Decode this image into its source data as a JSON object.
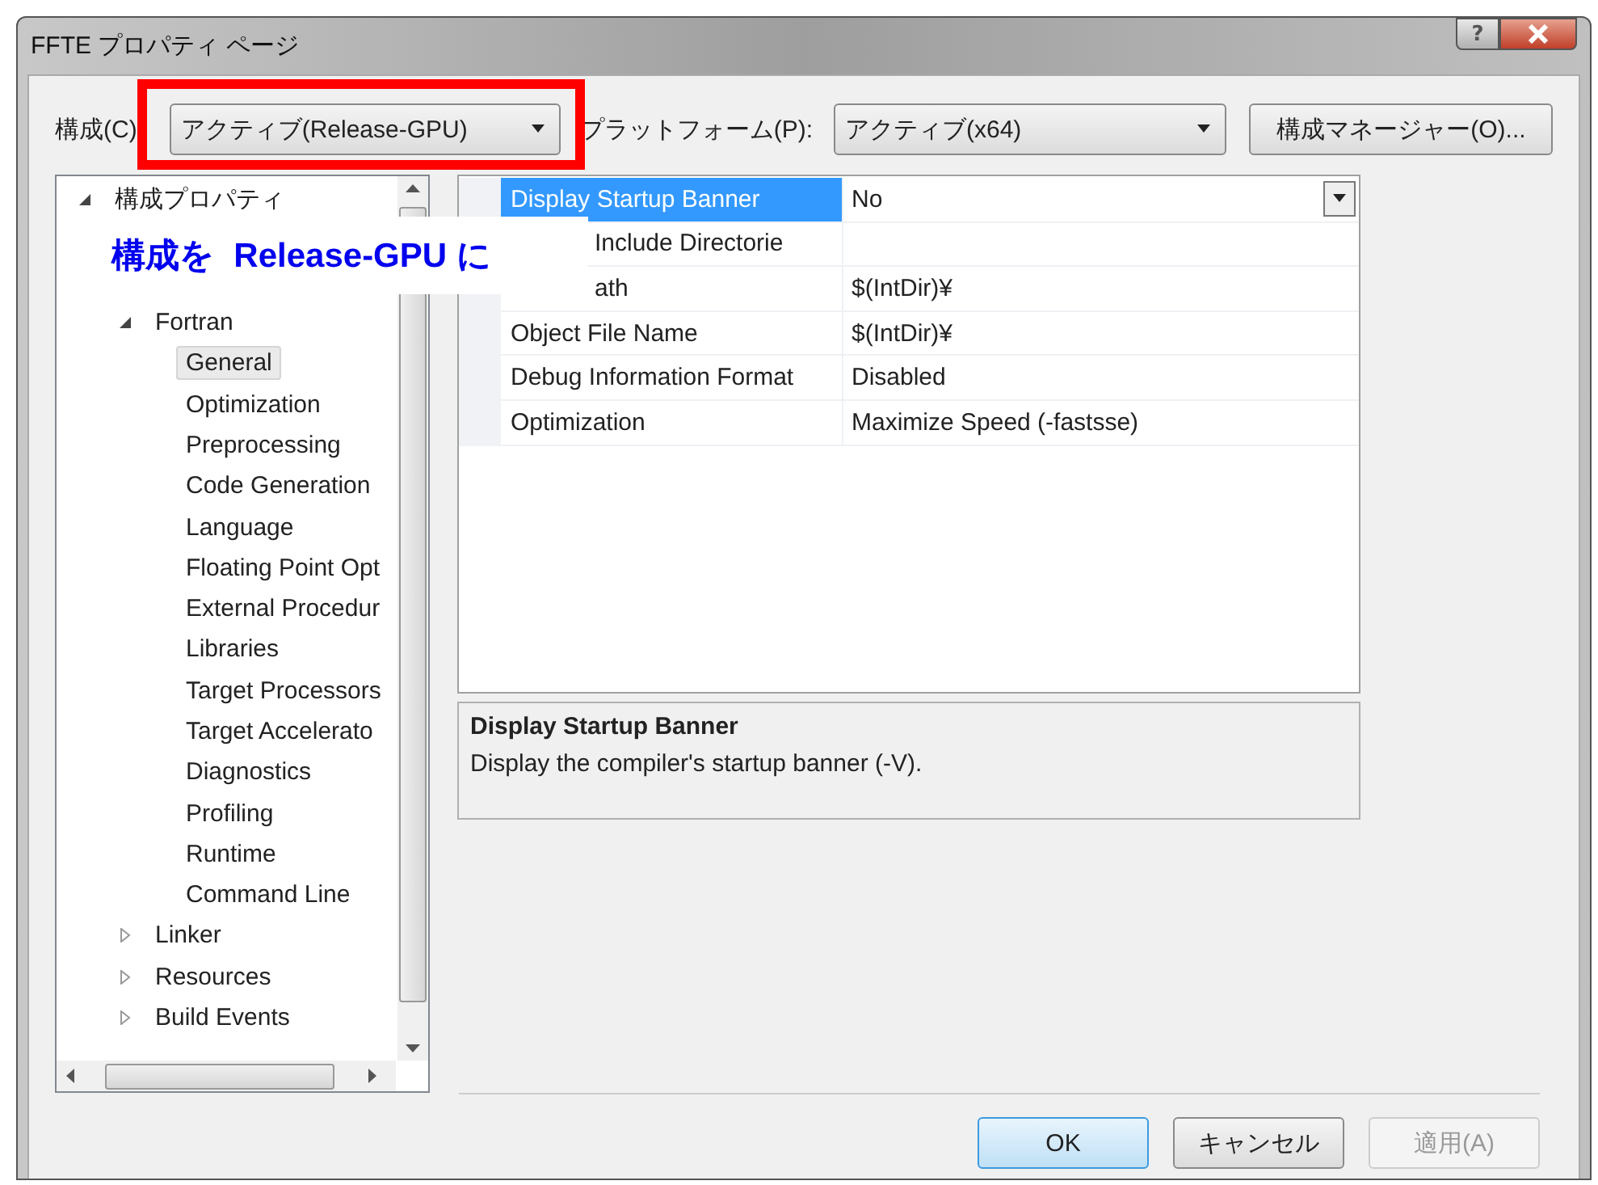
{
  "window": {
    "title": "FFTE プロパティ ページ",
    "help": "?"
  },
  "config": {
    "label": "構成(C)",
    "value": "アクティブ(Release-GPU)",
    "highlighted": true
  },
  "platform": {
    "label": "プラットフォーム(P):",
    "value": "アクティブ(x64)"
  },
  "config_manager": "構成マネージャー(O)...",
  "tree": [
    {
      "label": "構成プロパティ",
      "expanded": true,
      "selected": false,
      "children": [
        {
          "label": "Fortran",
          "expanded": true,
          "selected": false,
          "children": [
            {
              "label": "General",
              "selected": true
            },
            {
              "label": "Optimization",
              "selected": false
            },
            {
              "label": "Preprocessing",
              "selected": false
            },
            {
              "label": "Code Generation",
              "selected": false
            },
            {
              "label": "Language",
              "selected": false
            },
            {
              "label": "Floating Point Opt",
              "selected": false
            },
            {
              "label": "External Procedur",
              "selected": false
            },
            {
              "label": "Libraries",
              "selected": false
            },
            {
              "label": "Target Processors",
              "selected": false
            },
            {
              "label": "Target Accelerato",
              "selected": false
            },
            {
              "label": "Diagnostics",
              "selected": false
            },
            {
              "label": "Profiling",
              "selected": false
            },
            {
              "label": "Runtime",
              "selected": false
            },
            {
              "label": "Command Line",
              "selected": false
            }
          ]
        },
        {
          "label": "Linker",
          "expanded": false,
          "selected": false
        },
        {
          "label": "Resources",
          "expanded": false,
          "selected": false
        },
        {
          "label": "Build Events",
          "expanded": false,
          "selected": false
        }
      ]
    }
  ],
  "properties": [
    {
      "name": "Display Startup Banner",
      "value": "No",
      "selected": true,
      "covered": false
    },
    {
      "name": "Include Directorie",
      "selected": false,
      "covered": true
    },
    {
      "name": "ath",
      "value": "$(IntDir)¥",
      "selected": false,
      "covered": true
    },
    {
      "name": "Object File Name",
      "value": "$(IntDir)¥",
      "selected": false,
      "covered": false
    },
    {
      "name": "Debug Information Format",
      "value": "Disabled",
      "selected": false,
      "covered": false
    },
    {
      "name": "Optimization",
      "value": "Maximize Speed (-fastsse)",
      "selected": false,
      "covered": false
    }
  ],
  "description": {
    "title": "Display Startup Banner",
    "text": "Display the compiler's startup banner (-V)."
  },
  "annotation": {
    "text": "構成を  Release-GPU に"
  },
  "buttons": [
    {
      "label": "OK",
      "kind": "default",
      "disabled": false
    },
    {
      "label": "キャンセル",
      "kind": "normal",
      "disabled": false
    },
    {
      "label": "適用(A)",
      "kind": "normal",
      "disabled": true
    }
  ]
}
